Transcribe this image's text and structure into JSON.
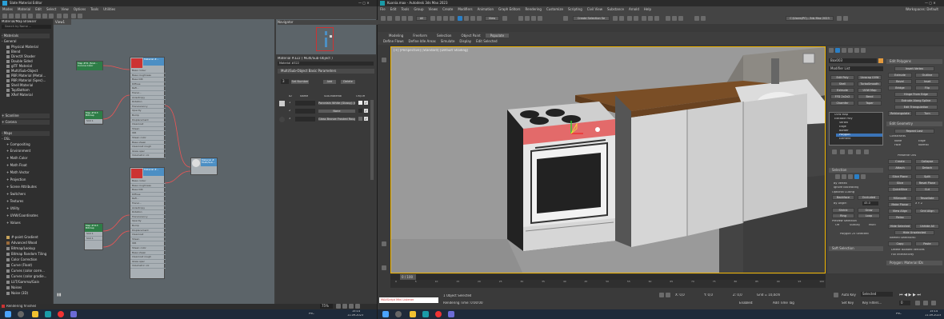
{
  "sme": {
    "title": "Slate Material Editor",
    "menu": [
      "Modes",
      "Material",
      "Edit",
      "Select",
      "View",
      "Options",
      "Tools",
      "Utilities"
    ],
    "browser_title": "Material/Map Browser",
    "browser_search": "Search by Name ...",
    "materials_header": "- Materials",
    "general_header": "- General",
    "general_items": [
      "Physical Material",
      "Blend",
      "DirectX Shader",
      "Double Sided",
      "gITF Material",
      "Multi/Sub-Object",
      "PBR Material (Metal...",
      "PBR Material (Spec)...",
      "Shell Material",
      "Top/Bottom",
      "XRef Material"
    ],
    "scanline": "+ Scanline",
    "corona": "+ Corona",
    "maps_header": "- Maps",
    "osl": "- OSL",
    "osl_groups": [
      "+ Compositing",
      "+ Environment",
      "+ Math Color",
      "+ Math Float",
      "+ Math Vector",
      "+ Projection",
      "+ Scene Attributes",
      "+ Switchers",
      "+ Textures",
      "+ Utility",
      "+ UVW/Coordinates",
      "+ Values"
    ],
    "map_items": [
      "#-point Gradient",
      "Advanced Wood",
      "Bitmap/Lookup",
      "Bitmap Random Tiling",
      "Color Correction",
      "Curve (Float)",
      "Curves (color corre...",
      "Curves (color gradie...",
      "LUT/Gamma/Gain",
      "Noises",
      "Noise (3D)"
    ],
    "view_tab": "View1",
    "navigator": "Navigator",
    "param_title": "Material #322  ( Multi/Sub-Object )",
    "param_name": "Material #322",
    "rollout": "Multi/Sub-Object Basic Parameters",
    "set_number": "Set Number",
    "count": "3",
    "sub_mat": "Sub-Material",
    "add": "Add",
    "delete": "Delete",
    "col_id": "ID",
    "col_name": "Name",
    "col_onoff": "On/Off",
    "rows": [
      {
        "id": "1",
        "mat": "Porcelain White (Glossy) (Corona...)"
      },
      {
        "id": "2",
        "mat": "None"
      },
      {
        "id": "3",
        "mat": "Glass Bronze Frosted Rough..."
      }
    ],
    "status": "Rendering finished",
    "zoom": "75%",
    "nodes": {
      "top_map": "Map #31 (Scal... Corona Color",
      "n1_title": "Map #313 Bitmap",
      "n1_slot": "Slot 1",
      "mat1": "Material #...",
      "mat2": "Material #...",
      "n2_title": "Map #313 Bitmap",
      "multisub": "Material # Multi/Sub..."
    },
    "slots": [
      "Base colour",
      "Base roughness",
      "Base IOR",
      "Diffuse",
      "Refl...",
      "Transl...",
      "Anisotropy",
      "Rotation",
      "Translucency",
      "Opacity",
      "Bump",
      "Displacement",
      "Clearcoat",
      "Sheen",
      "IOR",
      "Sheen color",
      "Base sheen",
      "Clearcoat rough",
      "Glass spec",
      "Volumetric col"
    ]
  },
  "max": {
    "title": "Kuxnia.max - Autodesk 3ds Max 2023",
    "workspaces": "Workspaces: Default",
    "menu": [
      "File",
      "Edit",
      "Tools",
      "Group",
      "Views",
      "Create",
      "Modifiers",
      "Animation",
      "Graph Editors",
      "Rendering",
      "Customize",
      "Scripting",
      "Civil View",
      "Substance",
      "Arnold",
      "Help"
    ],
    "selection_set": "Create Selection Se",
    "path": "C:\\Users\\PC\\...3ds Max 2023",
    "ribbon_tabs": [
      "Modeling",
      "Freeform",
      "Selection",
      "Object Paint",
      "Populate"
    ],
    "ribbon_sub": [
      "Define Flows",
      "Define Idle Areas",
      "Simulate",
      "Display",
      "Edit Selected"
    ],
    "viewport_label": "[+] [Perspective] [Standard] [Default Shading]",
    "object_name": "Box003",
    "modifier_list": "Modifier List",
    "mod_buttons": [
      "Edit Poly",
      "Unwrap UVW",
      "Shell",
      "TurboSmooth",
      "Extrude",
      "UVW Map",
      "FFD 2x2x2",
      "Bend",
      "Chamfer",
      "Taper"
    ],
    "stack": [
      "UVW Map",
      "Editable Poly",
      "Vertex",
      "Edge",
      "Border",
      "Polygon",
      "Element"
    ],
    "selection": "Selection",
    "by_vertex": "By Vertex",
    "ignore_backfacing": "Ignore Backfacing",
    "optional_culling": "Optional Culling",
    "backface": "Backface",
    "occluded": "Occluded",
    "by_angle": "By Angle:",
    "angle": "45.0",
    "shrink": "Shrink",
    "grow": "Grow",
    "ring": "Ring",
    "loop": "Loop",
    "preview_sel": "Preview Selection",
    "off": "Off",
    "subobj": "SubObj",
    "multi": "Multi",
    "poly_sel": "Polygon 25 Selected",
    "soft_sel": "Soft Selection",
    "edit_polygons": "Edit Polygons",
    "insert_vertex": "Insert Vertex",
    "ep_buttons": [
      "Extrude",
      "Outline",
      "Bevel",
      "Inset",
      "Bridge",
      "Flip"
    ],
    "hinge": "Hinge From Edge",
    "extrude_spline": "Extrude Along Spline",
    "edit_tri": "Edit Triangulation",
    "retriangulate": "Retriangulate",
    "turn": "Turn",
    "edit_geometry": "Edit Geometry",
    "repeat_last": "Repeat Last",
    "constraints": "Constraints",
    "none": "None",
    "edge": "Edge",
    "face": "Face",
    "normal": "Normal",
    "preserve_uvs": "Preserve UVs",
    "create": "Create",
    "collapse": "Collapse",
    "attach": "Attach",
    "detach": "Detach",
    "slice_plane": "Slice Plane",
    "split": "Split",
    "slice": "Slice",
    "reset_plane": "Reset Plane",
    "quickslice": "QuickSlice",
    "cut": "Cut",
    "msmooth": "MSmooth",
    "tessellate": "Tessellate",
    "make_planar": "Make Planar",
    "view_align": "View Align",
    "grid_align": "Grid Align",
    "relax": "Relax",
    "hide_selected": "Hide Selected",
    "unhide_all": "Unhide All",
    "hide_unselected": "Hide Unselected",
    "named_sel": "Named Selections:",
    "copy": "Copy",
    "paste": "Paste",
    "delete_isolated": "Delete Isolated Vertices",
    "full_interactivity": "Full Interactivity",
    "poly_mat_ids": "Polygon: Material IDs",
    "frame": "0 / 100",
    "timeline_ticks": [
      "0",
      "5",
      "10",
      "15",
      "20",
      "25",
      "30",
      "35",
      "40",
      "45",
      "50",
      "55",
      "60",
      "65",
      "70",
      "75",
      "80",
      "85",
      "90",
      "95",
      "100"
    ],
    "listener": "MAXScript Mini Listener",
    "status1": "1 Object Selected",
    "status2": "Rendering Time: 0:00:00",
    "x": "X: 0,0",
    "y": "Y: 0,0",
    "z": "Z: 0,0",
    "enabled": "Enabled:",
    "grid": "Grid = 10,0cm",
    "add_time_tag": "Add Time Tag",
    "auto_key": "Auto Key",
    "selected": "Selected",
    "set_key": "Set Key",
    "key_filters": "Key Filters...",
    "frame_num": "0"
  },
  "taskbar": {
    "time": "15:14",
    "date": "11.09.2023",
    "lang": "РУС",
    "time2": "15:14",
    "date2": "11.09.2023",
    "lang2": "РУС"
  }
}
